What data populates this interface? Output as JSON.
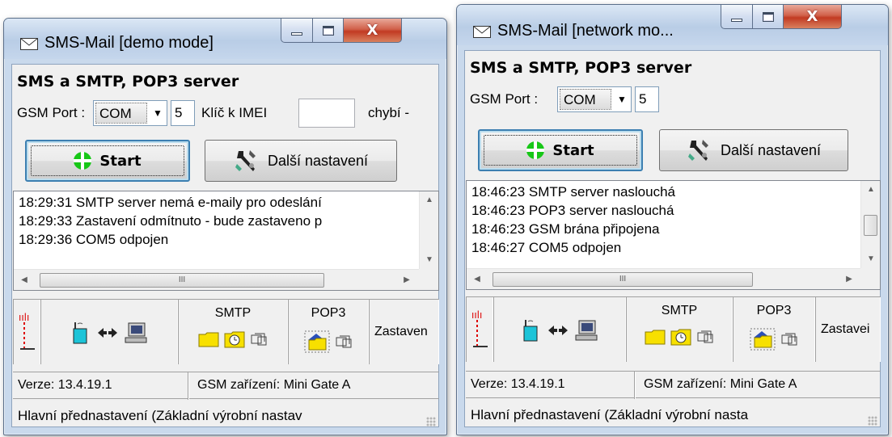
{
  "windows": [
    {
      "title": "SMS-Mail  [demo mode]",
      "heading": "SMS a SMTP, POP3 server",
      "gsm_port_label": "GSM Port :",
      "port_select": "COM",
      "port_number": "5",
      "imei_label": "Klíč k IMEI",
      "imei_value": "",
      "missing_label": "chybí -",
      "start_label": "Start",
      "settings_label": "Další nastavení",
      "log": [
        "18:29:31  SMTP server nemá e-maily pro odeslání",
        "18:29:33  Zastavení odmítnuto - bude zastaveno p",
        "18:29:36  COM5 odpojen"
      ],
      "scroll_thumb_label": "III",
      "smtp_label": "SMTP",
      "pop3_label": "POP3",
      "stop_label": "Zastaven",
      "version": "Verze: 13.4.19.1",
      "device": "GSM zařízení: Mini Gate A",
      "profile": "Hlavní přednastavení (Základní výrobní nastav"
    },
    {
      "title": "SMS-Mail  [network mo...",
      "heading": "SMS a SMTP, POP3 server",
      "gsm_port_label": "GSM Port :",
      "port_select": "COM",
      "port_number": "5",
      "start_label": "Start",
      "settings_label": "Další nastavení",
      "log": [
        "18:46:23  SMTP server naslouchá",
        "18:46:23  POP3 server naslouchá",
        "18:46:23  GSM brána připojena",
        "18:46:27  COM5 odpojen"
      ],
      "scroll_thumb_label": "III",
      "smtp_label": "SMTP",
      "pop3_label": "POP3",
      "stop_label": "Zastavei",
      "version": "Verze: 13.4.19.1",
      "device": "GSM zařízení: Mini Gate A",
      "profile": "Hlavní přednastavení (Základní výrobní nasta"
    }
  ],
  "icons": {
    "title": "envelope-icon",
    "start": "green-plus-icon",
    "settings": "tools-icon",
    "antenna": "antenna-icon",
    "gsm": "gsm-modem-icon",
    "link": "bidirectional-arrows-icon",
    "computer": "computer-icon",
    "folder": "folder-icon",
    "clock_folder": "scheduled-icon",
    "queue": "queue-icon",
    "pop3_folder": "mailbox-folder-icon"
  },
  "colors": {
    "window_frame": "#c9d9ec",
    "close_button": "#c23a22",
    "start_plus": "#17c717",
    "folder": "#f7e000"
  }
}
